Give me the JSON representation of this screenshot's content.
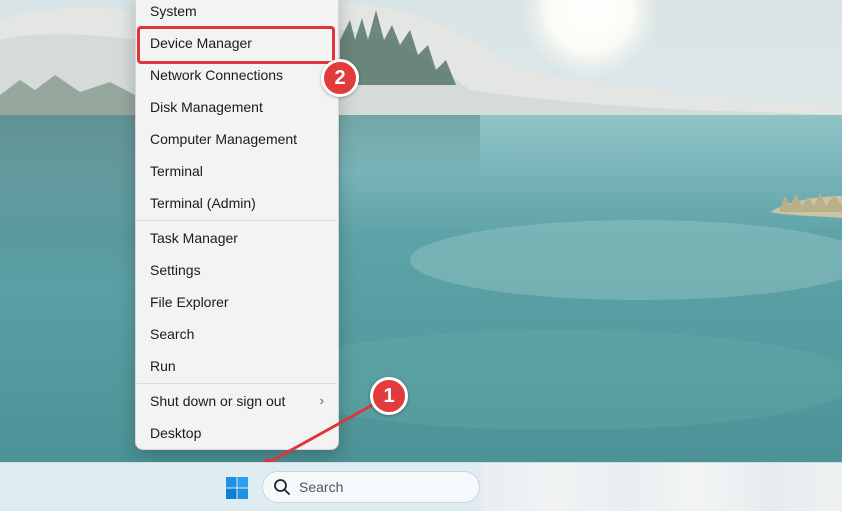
{
  "menu": {
    "items": [
      {
        "label": "System"
      },
      {
        "label": "Device Manager"
      },
      {
        "label": "Network Connections"
      },
      {
        "label": "Disk Management"
      },
      {
        "label": "Computer Management"
      },
      {
        "label": "Terminal"
      },
      {
        "label": "Terminal (Admin)"
      },
      {
        "label": "Task Manager"
      },
      {
        "label": "Settings"
      },
      {
        "label": "File Explorer"
      },
      {
        "label": "Search"
      },
      {
        "label": "Run"
      },
      {
        "label": "Shut down or sign out"
      },
      {
        "label": "Desktop"
      }
    ],
    "submenu_chevron": "›",
    "highlighted_item": "Device Manager"
  },
  "callouts": {
    "start_step": "1",
    "menu_step": "2",
    "color": "#e23b3b"
  },
  "taskbar": {
    "search_placeholder": "Search",
    "start_icon": "windows-logo-icon",
    "search_icon": "magnifier-icon"
  }
}
